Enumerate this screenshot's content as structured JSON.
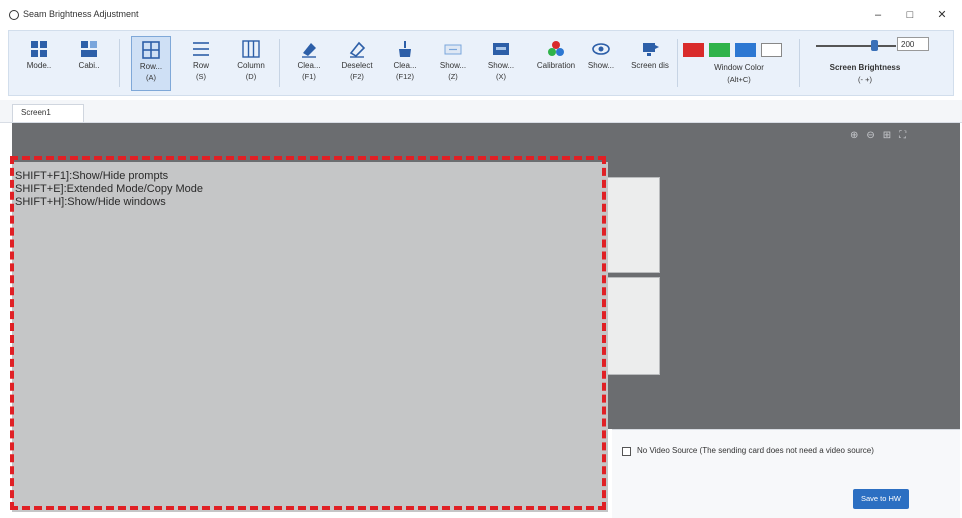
{
  "window": {
    "title": "Seam Brightness Adjustment",
    "minimize_glyph": "–",
    "maximize_glyph": "□",
    "close_glyph": "✕"
  },
  "toolbar": {
    "tools": [
      {
        "label": "Mode..",
        "shortcut": "",
        "icon": "grid-mode-icon"
      },
      {
        "label": "Cabi..",
        "shortcut": "",
        "icon": "cabinet-icon"
      },
      {
        "label": "Row...",
        "shortcut": "(A)",
        "icon": "row-column-icon",
        "active": true
      },
      {
        "label": "Row",
        "shortcut": "(S)",
        "icon": "row-icon"
      },
      {
        "label": "Column",
        "shortcut": "(D)",
        "icon": "column-icon"
      },
      {
        "label": "Clea...",
        "shortcut": "(F1)",
        "icon": "eraser-icon"
      },
      {
        "label": "Deselect",
        "shortcut": "(F2)",
        "icon": "deselect-icon"
      },
      {
        "label": "Clea...",
        "shortcut": "(F12)",
        "icon": "clear-all-icon"
      },
      {
        "label": "Show...",
        "shortcut": "(Z)",
        "icon": "show-icon"
      },
      {
        "label": "Show...",
        "shortcut": "(X)",
        "icon": "show-screen-icon"
      },
      {
        "label": "Calibration",
        "shortcut": "",
        "icon": "calibration-icon"
      },
      {
        "label": "Show...",
        "shortcut": "",
        "icon": "eye-icon"
      },
      {
        "label": "Screen dis",
        "shortcut": "",
        "icon": "screen-display-icon"
      }
    ],
    "window_color": {
      "label": "Window Color",
      "shortcut": "(Alt+C)",
      "swatches": [
        "#d92b2b",
        "#2fb34a",
        "#2d78d2",
        "#ffffff"
      ]
    },
    "screen_brightness": {
      "label": "Screen Brightness",
      "shortcut": "(- +)",
      "value": "200",
      "level": 0.625
    }
  },
  "tabs": [
    {
      "label": "Screen1"
    }
  ],
  "prompts": [
    "SHIFT+F1]:Show/Hide prompts",
    "SHIFT+E]:Extended Mode/Copy Mode",
    "SHIFT+H]:Show/Hide windows"
  ],
  "bottom": {
    "no_video_source_label": "No Video Source  (The sending card does not need a video source)",
    "save_button": "Save to HW"
  },
  "colors": {
    "accent": "#2c6fc2",
    "canvas": "#6b6d70",
    "highlight_dash": "#e02025"
  }
}
